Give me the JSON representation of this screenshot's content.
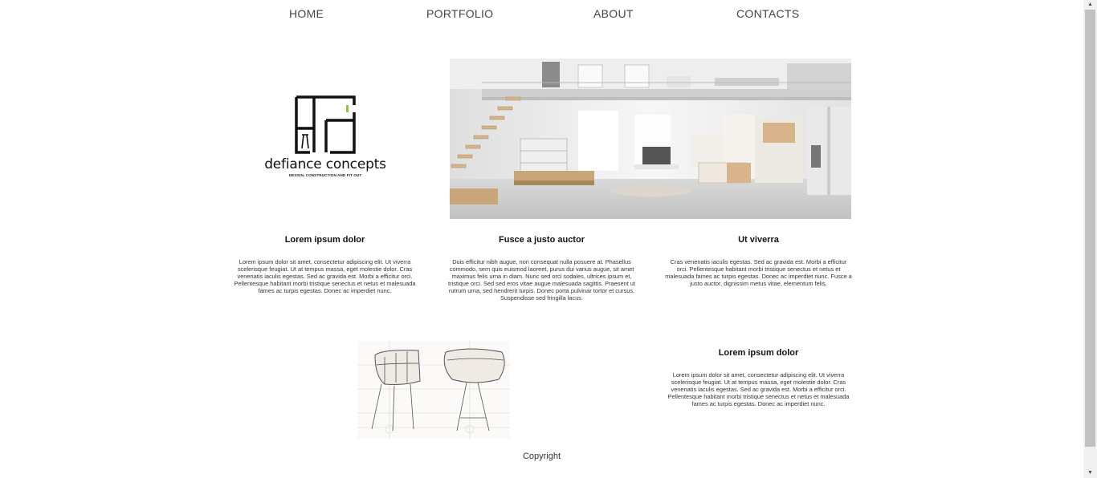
{
  "nav": {
    "home": "HOME",
    "portfolio": "PORTFOLIO",
    "about": "ABOUT",
    "contacts": "CONTACTS"
  },
  "logo": {
    "name": "defiance concepts",
    "tagline": "DESIGN, CONSTRUCTION AND FIT OUT",
    "accent_color": "#8dc63f"
  },
  "columns": [
    {
      "title": "Lorem ipsum dolor",
      "text": "Lorem ipsum dolor sit amet, consectetur adipiscing elit. Ut viverra scelerisque feugiat. Ut at tempus massa, eget molestie dolor. Cras venenatis iaculis egestas. Sed ac gravida est. Morbi a efficitur orci. Pellentesque habitant morbi tristique senectus et netus et malesuada fames ac turpis egestas. Donec ac imperdiet nunc."
    },
    {
      "title": "Fusce a justo auctor",
      "text": "Duis efficitur nibh augue, non consequat nulla posuere at. Phasellus commodo, sem quis euismod laoreet, purus dui varius augue, sit amet maximus felis urna in diam. Nunc sed orci sodales, ultrices ipsum et, tristique orci. Sed sed eros vitae augue malesuada sagittis. Praesent ut rutrum urna, sed hendrerit turpis. Donec porta pulvinar tortor et cursus. Suspendisse sed fringilla lacus."
    },
    {
      "title": "Ut viverra",
      "text": "Cras venenatis iaculis egestas. Sed ac gravida est. Morbi a efficitur orci. Pellentesque habitant morbi tristique senectus et netus et malesuada fames ac turpis egestas. Donec ac imperdiet nunc. Fusce a justo auctor, dignissim metus vitae, elementum felis."
    },
    {
      "title": "Lorem ipsum dolor",
      "text": "Lorem ipsum dolor sit amet, consectetur adipiscing elit. Ut viverra scelerisque feugiat. Ut at tempus massa, eget molestie dolor. Cras venenatis iaculis egestas. Sed ac gravida est. Morbi a efficitur orci. Pellentesque habitant morbi tristique senectus et netus et malesuada fames ac turpis egestas. Donec ac imperdiet nunc."
    }
  ],
  "footer": {
    "copyright": "Copyright"
  },
  "icons": {
    "scroll_up": "scroll-up-arrow-icon",
    "scroll_down": "scroll-down-arrow-icon"
  }
}
